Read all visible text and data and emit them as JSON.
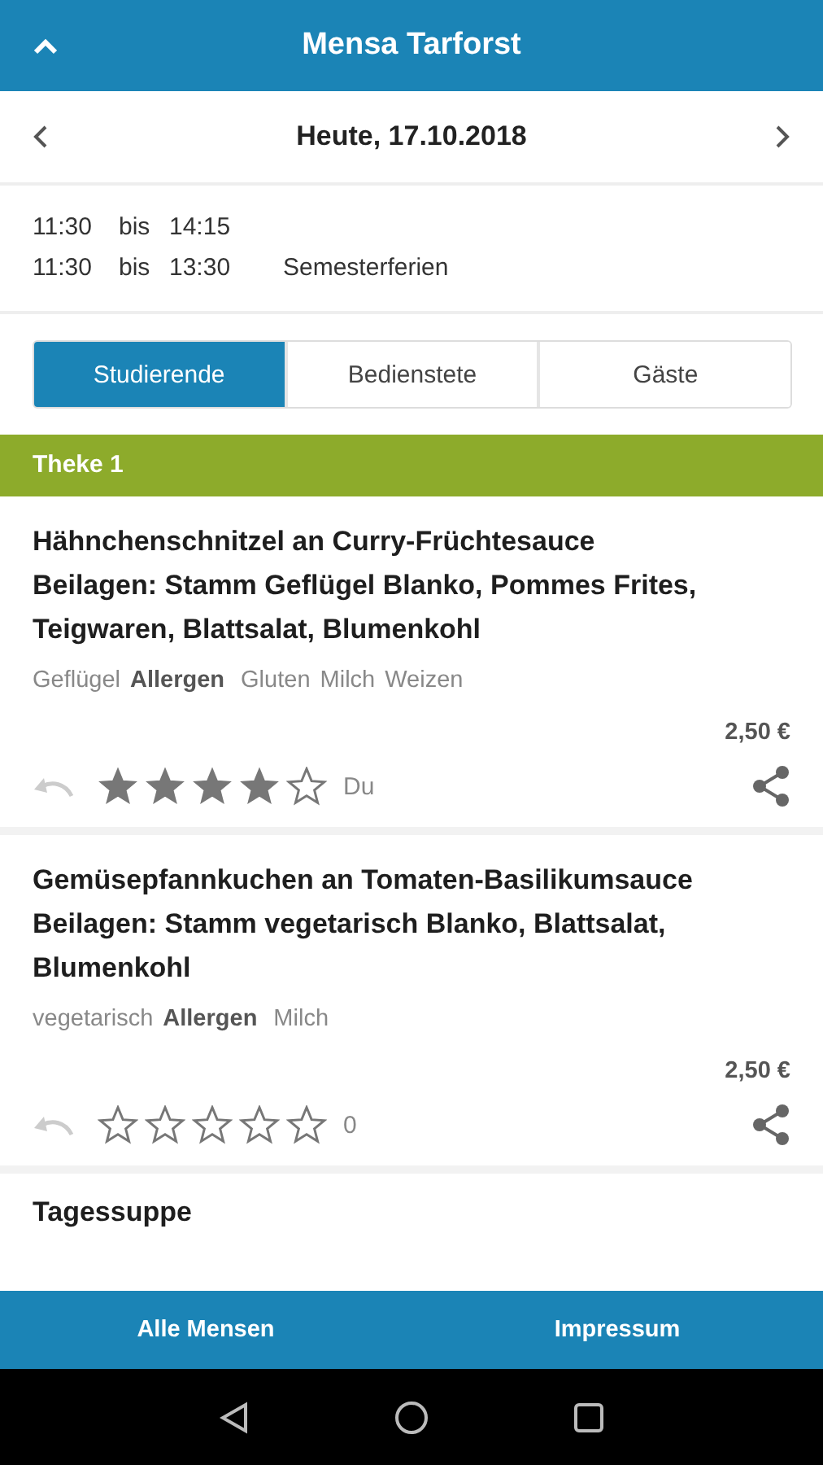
{
  "header": {
    "title": "Mensa Tarforst"
  },
  "date_bar": {
    "label": "Heute, 17.10.2018"
  },
  "opening_hours": [
    {
      "from": "11:30",
      "sep": "bis",
      "to": "14:15"
    },
    {
      "from": "11:30",
      "sep": "bis",
      "to": "13:30",
      "note": "Semesterferien"
    }
  ],
  "price_groups": [
    {
      "label": "Studierende",
      "selected": true
    },
    {
      "label": "Bedienstete",
      "selected": false
    },
    {
      "label": "Gäste",
      "selected": false
    }
  ],
  "section": {
    "title": "Theke 1"
  },
  "meals": [
    {
      "title": "Hähnchenschnitzel an Curry-Früchtesauce",
      "sides": "Beilagen: Stamm Geflügel Blanko, Pommes Frites, Teigwaren, Blattsalat, Blumenkohl",
      "tags": [
        {
          "kind": "category",
          "text": "Geflügel"
        },
        {
          "kind": "heading",
          "text": "Allergen"
        },
        {
          "kind": "allergen",
          "text": "Gluten"
        },
        {
          "kind": "allergen",
          "text": "Milch"
        },
        {
          "kind": "allergen",
          "text": "Weizen"
        }
      ],
      "price": "2,50 €",
      "stars": 4,
      "rating_label": "Du"
    },
    {
      "title": "Gemüsepfannkuchen an Tomaten-Basilikumsauce",
      "sides": "Beilagen: Stamm vegetarisch Blanko, Blattsalat, Blumenkohl",
      "tags": [
        {
          "kind": "category",
          "text": "vegetarisch"
        },
        {
          "kind": "heading",
          "text": "Allergen"
        },
        {
          "kind": "allergen",
          "text": "Milch"
        }
      ],
      "price": "2,50 €",
      "stars": 0,
      "rating_label": "0"
    }
  ],
  "next_meal_partial": {
    "title": "Tagessuppe"
  },
  "footer": [
    {
      "label": "Alle Mensen"
    },
    {
      "label": "Impressum"
    }
  ]
}
